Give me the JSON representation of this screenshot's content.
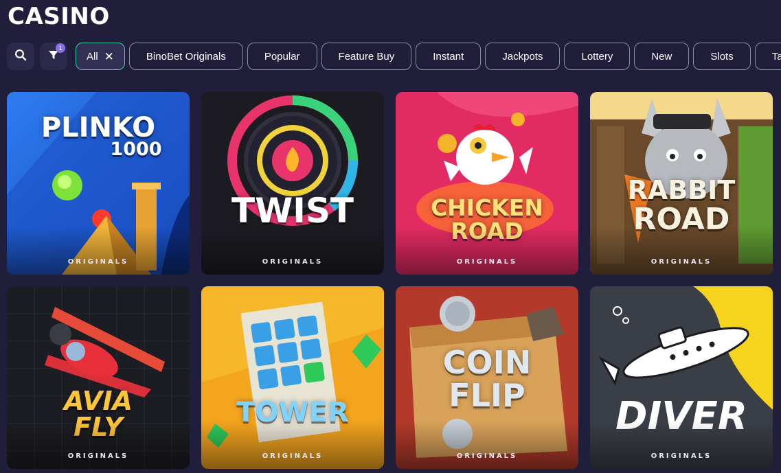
{
  "header": {
    "title": "CASINO"
  },
  "filters": {
    "search_icon": "search-icon",
    "filter_icon": "filter-icon",
    "filter_count": "1",
    "chips": [
      {
        "label": "All",
        "active": true
      },
      {
        "label": "BinoBet Originals",
        "active": false
      },
      {
        "label": "Popular",
        "active": false
      },
      {
        "label": "Feature Buy",
        "active": false
      },
      {
        "label": "Instant",
        "active": false
      },
      {
        "label": "Jackpots",
        "active": false
      },
      {
        "label": "Lottery",
        "active": false
      },
      {
        "label": "New",
        "active": false
      },
      {
        "label": "Slots",
        "active": false
      },
      {
        "label": "Table",
        "active": false
      }
    ],
    "active_accent": "#3ad2a0"
  },
  "games": [
    {
      "logo_line1": "PLINKO",
      "logo_line2": "1000",
      "tag": "ORIGINALS",
      "bg": "#1f5fd1"
    },
    {
      "logo_line1": "TWIST",
      "logo_line2": "",
      "tag": "ORIGINALS",
      "bg": "#1b1a22"
    },
    {
      "logo_line1": "CHICKEN",
      "logo_line2": "ROAD",
      "tag": "ORIGINALS",
      "bg": "#e0205e"
    },
    {
      "logo_line1": "RABBIT",
      "logo_line2": "ROAD",
      "tag": "ORIGINALS",
      "bg": "#5e8a2e"
    },
    {
      "logo_line1": "AVIA",
      "logo_line2": "FLY",
      "tag": "ORIGINALS",
      "bg": "#1b1c20"
    },
    {
      "logo_line1": "TOWER",
      "logo_line2": "",
      "tag": "ORIGINALS",
      "bg": "#f0a21c"
    },
    {
      "logo_line1": "COIN",
      "logo_line2": "FLIP",
      "tag": "ORIGINALS",
      "bg": "#b23a2c"
    },
    {
      "logo_line1": "DIVER",
      "logo_line2": "",
      "tag": "ORIGINALS",
      "bg": "#3b3f47"
    }
  ]
}
